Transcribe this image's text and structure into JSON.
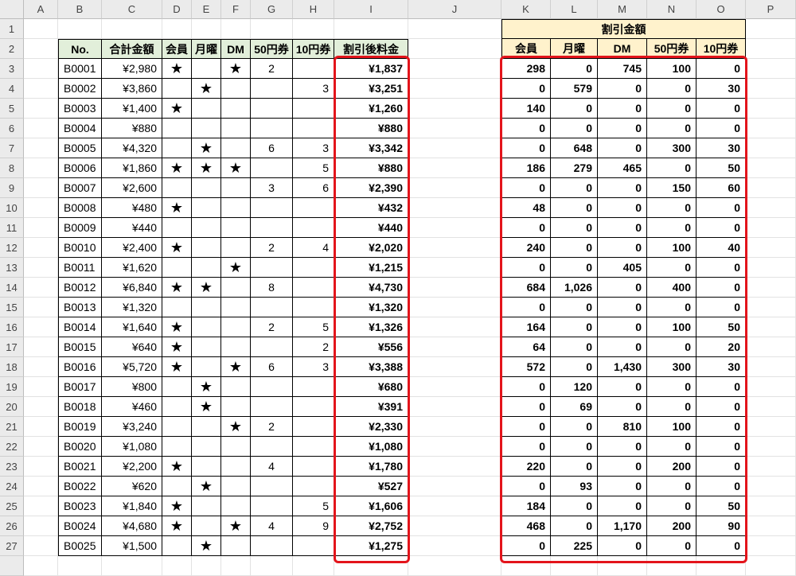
{
  "columns": [
    "A",
    "B",
    "C",
    "D",
    "E",
    "F",
    "G",
    "H",
    "I",
    "J",
    "K",
    "L",
    "M",
    "N",
    "O",
    "P"
  ],
  "header_row": {
    "no": "No.",
    "total": "合計金額",
    "member": "会員",
    "monday": "月曜",
    "dm": "DM",
    "coupon50": "50円券",
    "coupon10": "10円券",
    "after": "割引後料金",
    "discount_group": "割引金額",
    "d_member": "会員",
    "d_monday": "月曜",
    "d_dm": "DM",
    "d_coupon50": "50円券",
    "d_coupon10": "10円券"
  },
  "star_symbol": "★",
  "colors": {
    "left_header_fill": "#e2efda",
    "right_header_fill": "#fff2cc",
    "highlight_border": "#e3141b"
  },
  "rows": [
    {
      "r": "3",
      "no": "B0001",
      "total": "¥2,980",
      "member": true,
      "monday": false,
      "dm": true,
      "c50": "2",
      "c10": "",
      "after": "¥1,837",
      "dm_": "298",
      "dmo": "0",
      "ddm": "745",
      "d50": "100",
      "d10": "0"
    },
    {
      "r": "4",
      "no": "B0002",
      "total": "¥3,860",
      "member": false,
      "monday": true,
      "dm": false,
      "c50": "",
      "c10": "3",
      "after": "¥3,251",
      "dm_": "0",
      "dmo": "579",
      "ddm": "0",
      "d50": "0",
      "d10": "30"
    },
    {
      "r": "5",
      "no": "B0003",
      "total": "¥1,400",
      "member": true,
      "monday": false,
      "dm": false,
      "c50": "",
      "c10": "",
      "after": "¥1,260",
      "dm_": "140",
      "dmo": "0",
      "ddm": "0",
      "d50": "0",
      "d10": "0"
    },
    {
      "r": "6",
      "no": "B0004",
      "total": "¥880",
      "member": false,
      "monday": false,
      "dm": false,
      "c50": "",
      "c10": "",
      "after": "¥880",
      "dm_": "0",
      "dmo": "0",
      "ddm": "0",
      "d50": "0",
      "d10": "0"
    },
    {
      "r": "7",
      "no": "B0005",
      "total": "¥4,320",
      "member": false,
      "monday": true,
      "dm": false,
      "c50": "6",
      "c10": "3",
      "after": "¥3,342",
      "dm_": "0",
      "dmo": "648",
      "ddm": "0",
      "d50": "300",
      "d10": "30"
    },
    {
      "r": "8",
      "no": "B0006",
      "total": "¥1,860",
      "member": true,
      "monday": true,
      "dm": true,
      "c50": "",
      "c10": "5",
      "after": "¥880",
      "dm_": "186",
      "dmo": "279",
      "ddm": "465",
      "d50": "0",
      "d10": "50"
    },
    {
      "r": "9",
      "no": "B0007",
      "total": "¥2,600",
      "member": false,
      "monday": false,
      "dm": false,
      "c50": "3",
      "c10": "6",
      "after": "¥2,390",
      "dm_": "0",
      "dmo": "0",
      "ddm": "0",
      "d50": "150",
      "d10": "60"
    },
    {
      "r": "10",
      "no": "B0008",
      "total": "¥480",
      "member": true,
      "monday": false,
      "dm": false,
      "c50": "",
      "c10": "",
      "after": "¥432",
      "dm_": "48",
      "dmo": "0",
      "ddm": "0",
      "d50": "0",
      "d10": "0"
    },
    {
      "r": "11",
      "no": "B0009",
      "total": "¥440",
      "member": false,
      "monday": false,
      "dm": false,
      "c50": "",
      "c10": "",
      "after": "¥440",
      "dm_": "0",
      "dmo": "0",
      "ddm": "0",
      "d50": "0",
      "d10": "0"
    },
    {
      "r": "12",
      "no": "B0010",
      "total": "¥2,400",
      "member": true,
      "monday": false,
      "dm": false,
      "c50": "2",
      "c10": "4",
      "after": "¥2,020",
      "dm_": "240",
      "dmo": "0",
      "ddm": "0",
      "d50": "100",
      "d10": "40"
    },
    {
      "r": "13",
      "no": "B0011",
      "total": "¥1,620",
      "member": false,
      "monday": false,
      "dm": true,
      "c50": "",
      "c10": "",
      "after": "¥1,215",
      "dm_": "0",
      "dmo": "0",
      "ddm": "405",
      "d50": "0",
      "d10": "0"
    },
    {
      "r": "14",
      "no": "B0012",
      "total": "¥6,840",
      "member": true,
      "monday": true,
      "dm": false,
      "c50": "8",
      "c10": "",
      "after": "¥4,730",
      "dm_": "684",
      "dmo": "1,026",
      "ddm": "0",
      "d50": "400",
      "d10": "0"
    },
    {
      "r": "15",
      "no": "B0013",
      "total": "¥1,320",
      "member": false,
      "monday": false,
      "dm": false,
      "c50": "",
      "c10": "",
      "after": "¥1,320",
      "dm_": "0",
      "dmo": "0",
      "ddm": "0",
      "d50": "0",
      "d10": "0"
    },
    {
      "r": "16",
      "no": "B0014",
      "total": "¥1,640",
      "member": true,
      "monday": false,
      "dm": false,
      "c50": "2",
      "c10": "5",
      "after": "¥1,326",
      "dm_": "164",
      "dmo": "0",
      "ddm": "0",
      "d50": "100",
      "d10": "50"
    },
    {
      "r": "17",
      "no": "B0015",
      "total": "¥640",
      "member": true,
      "monday": false,
      "dm": false,
      "c50": "",
      "c10": "2",
      "after": "¥556",
      "dm_": "64",
      "dmo": "0",
      "ddm": "0",
      "d50": "0",
      "d10": "20"
    },
    {
      "r": "18",
      "no": "B0016",
      "total": "¥5,720",
      "member": true,
      "monday": false,
      "dm": true,
      "c50": "6",
      "c10": "3",
      "after": "¥3,388",
      "dm_": "572",
      "dmo": "0",
      "ddm": "1,430",
      "d50": "300",
      "d10": "30"
    },
    {
      "r": "19",
      "no": "B0017",
      "total": "¥800",
      "member": false,
      "monday": true,
      "dm": false,
      "c50": "",
      "c10": "",
      "after": "¥680",
      "dm_": "0",
      "dmo": "120",
      "ddm": "0",
      "d50": "0",
      "d10": "0"
    },
    {
      "r": "20",
      "no": "B0018",
      "total": "¥460",
      "member": false,
      "monday": true,
      "dm": false,
      "c50": "",
      "c10": "",
      "after": "¥391",
      "dm_": "0",
      "dmo": "69",
      "ddm": "0",
      "d50": "0",
      "d10": "0"
    },
    {
      "r": "21",
      "no": "B0019",
      "total": "¥3,240",
      "member": false,
      "monday": false,
      "dm": true,
      "c50": "2",
      "c10": "",
      "after": "¥2,330",
      "dm_": "0",
      "dmo": "0",
      "ddm": "810",
      "d50": "100",
      "d10": "0"
    },
    {
      "r": "22",
      "no": "B0020",
      "total": "¥1,080",
      "member": false,
      "monday": false,
      "dm": false,
      "c50": "",
      "c10": "",
      "after": "¥1,080",
      "dm_": "0",
      "dmo": "0",
      "ddm": "0",
      "d50": "0",
      "d10": "0"
    },
    {
      "r": "23",
      "no": "B0021",
      "total": "¥2,200",
      "member": true,
      "monday": false,
      "dm": false,
      "c50": "4",
      "c10": "",
      "after": "¥1,780",
      "dm_": "220",
      "dmo": "0",
      "ddm": "0",
      "d50": "200",
      "d10": "0"
    },
    {
      "r": "24",
      "no": "B0022",
      "total": "¥620",
      "member": false,
      "monday": true,
      "dm": false,
      "c50": "",
      "c10": "",
      "after": "¥527",
      "dm_": "0",
      "dmo": "93",
      "ddm": "0",
      "d50": "0",
      "d10": "0"
    },
    {
      "r": "25",
      "no": "B0023",
      "total": "¥1,840",
      "member": true,
      "monday": false,
      "dm": false,
      "c50": "",
      "c10": "5",
      "after": "¥1,606",
      "dm_": "184",
      "dmo": "0",
      "ddm": "0",
      "d50": "0",
      "d10": "50"
    },
    {
      "r": "26",
      "no": "B0024",
      "total": "¥4,680",
      "member": true,
      "monday": false,
      "dm": true,
      "c50": "4",
      "c10": "9",
      "after": "¥2,752",
      "dm_": "468",
      "dmo": "0",
      "ddm": "1,170",
      "d50": "200",
      "d10": "90"
    },
    {
      "r": "27",
      "no": "B0025",
      "total": "¥1,500",
      "member": false,
      "monday": true,
      "dm": false,
      "c50": "",
      "c10": "",
      "after": "¥1,275",
      "dm_": "0",
      "dmo": "225",
      "ddm": "0",
      "d50": "0",
      "d10": "0"
    }
  ]
}
